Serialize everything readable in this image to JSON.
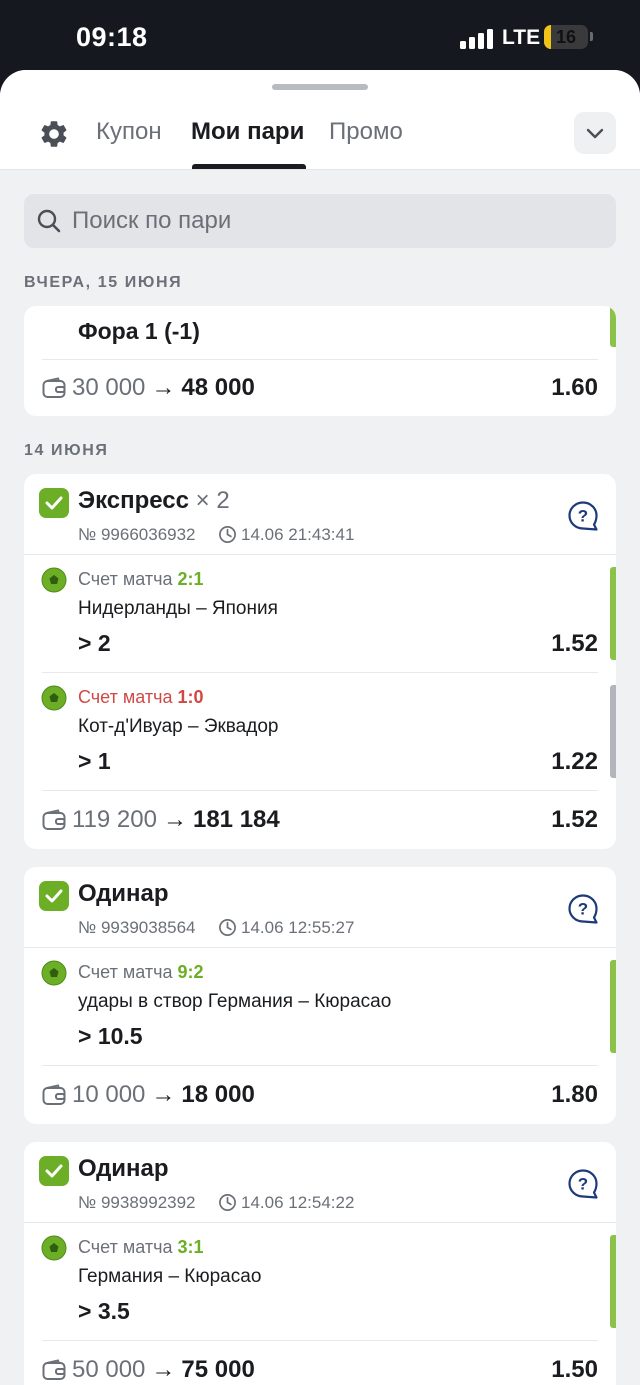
{
  "status_bar": {
    "time": "09:18",
    "network": "LTE",
    "battery": "16",
    "battery_level": 0.16
  },
  "header": {
    "tabs": [
      {
        "label": "Купон",
        "active": false
      },
      {
        "label": "Мои пари",
        "active": true
      },
      {
        "label": "Промо",
        "active": false
      }
    ]
  },
  "search": {
    "placeholder": "Поиск по пари",
    "value": ""
  },
  "sections": [
    {
      "label": "ВЧЕРА, 15 ИЮНЯ"
    },
    {
      "label": "14 ИЮНЯ"
    }
  ],
  "colors": {
    "won": "#6cae25",
    "lost": "#cf4a44",
    "won_bar": "#8bc34a",
    "lost_bar": "#b2b6bc"
  },
  "partial_bet": {
    "selection": {
      "outcome": "Фора 1 (-1)",
      "result": "won"
    },
    "stake": "30 000",
    "arrow": "→",
    "payout": "48 000",
    "total_odds": "1.60"
  },
  "bets": [
    {
      "type": "Экспресс",
      "multiplier": "× 2",
      "number": "№ 9966036932",
      "datetime": "14.06 21:43:41",
      "selections": [
        {
          "status_label": "Счет матча",
          "score": "2:1",
          "result": "won",
          "event": "Нидерланды – Япония",
          "outcome": "> 2",
          "odds": "1.52"
        },
        {
          "status_label": "Счет матча",
          "score": "1:0",
          "result": "lost",
          "event": "Кот-д'Ивуар – Эквадор",
          "outcome": "> 1",
          "odds": "1.22"
        }
      ],
      "stake": "119 200",
      "arrow": "→",
      "payout": "181 184",
      "total_odds": "1.52"
    },
    {
      "type": "Одинар",
      "multiplier": "",
      "number": "№ 9939038564",
      "datetime": "14.06 12:55:27",
      "selections": [
        {
          "status_label": "Счет матча",
          "score": "9:2",
          "result": "won",
          "event": "удары в створ Германия – Кюрасао",
          "outcome": "> 10.5",
          "odds": ""
        }
      ],
      "stake": "10 000",
      "arrow": "→",
      "payout": "18 000",
      "total_odds": "1.80"
    },
    {
      "type": "Одинар",
      "multiplier": "",
      "number": "№ 9938992392",
      "datetime": "14.06 12:54:22",
      "selections": [
        {
          "status_label": "Счет матча",
          "score": "3:1",
          "result": "won",
          "event": "Германия – Кюрасао",
          "outcome": "> 3.5",
          "odds": ""
        }
      ],
      "stake": "50 000",
      "arrow": "→",
      "payout": "75 000",
      "total_odds": "1.50"
    }
  ]
}
